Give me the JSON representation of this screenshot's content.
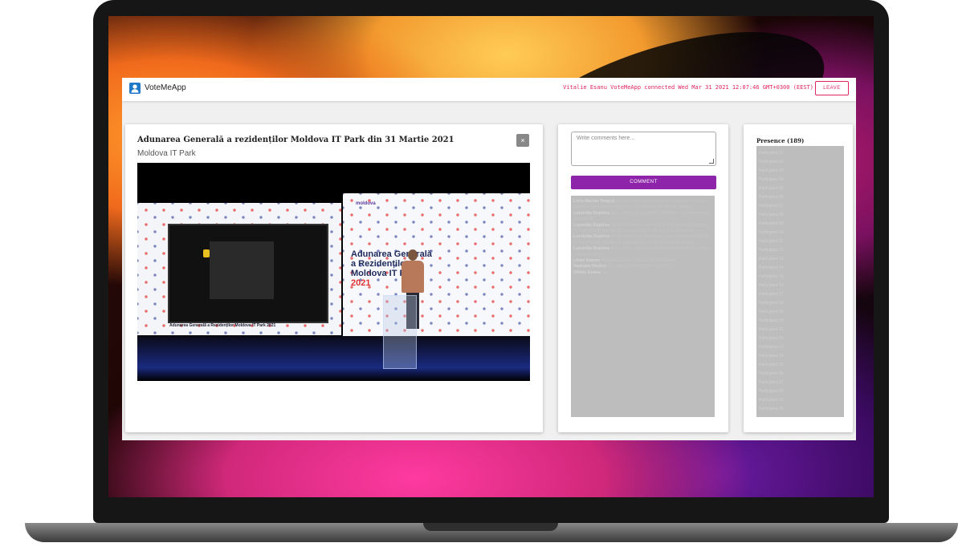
{
  "header": {
    "app_title": "VoteMeApp",
    "status": "Vitalie Esanu VoteMeApp connected Wed Mar 31 2021 12:07:46 GMT+0300 (EEST)",
    "leave_label": "LEAVE"
  },
  "meeting": {
    "title": "Adunarea Generală a rezidenților Moldova IT Park din 31 Martie 2021",
    "organization": "Moldova IT Park",
    "close_label": "×",
    "video": {
      "left_caption": "Adunarea Generală a Rezidenților Moldova IT Park 2021",
      "right_logo": "moldova",
      "right_heading_1": "Adunarea Generală",
      "right_heading_2": "a Rezidenților",
      "right_heading_3": "Moldova IT Park",
      "right_year": "2021"
    }
  },
  "comments": {
    "placeholder": "Write comments here...",
    "button_label": "COMMENT",
    "items": [
      {
        "author": "Liviu Marian Negruț",
        "text": "Permis slide-ul prezentat mai departe a ca sa raportul rezultatele in engleza sau romana pe adunari anuala"
      },
      {
        "author": "Luminița Dupîrea",
        "text": "Elise afisează de grande a trimitere la prezentarea uploadată"
      },
      {
        "author": "Luminița Dupîrea",
        "text": "Tema: Adunarea Generală a Rezidenților Moldova IT Park (Q&A) Atenție 31 martie 2021 11:00 AM Ora Moldovei"
      },
      {
        "author": "Luminița Dupîrea",
        "text": "Tema: Adunarea Generală a Rezidenților Moldova IT Park (Q&A) Atenție 31 martie 2021 11:00 AM Ora Moldovei"
      },
      {
        "author": "Luminița Dupîrea",
        "text": "Bună ziua, vă rugăm să lăsați întrebările aici pentru sesiunea Q&A"
      },
      {
        "author": "Lilian Ivanov",
        "text": "Întrebare pentru Q&A după prezentare"
      },
      {
        "author": "Nadejda Hodiuc",
        "text": "Da, aștept răspunsurile voastre"
      },
      {
        "author": "Vitalie Esanu",
        "text": "Da"
      }
    ]
  },
  "presence": {
    "title": "Presence (189)",
    "members": [
      "Participant 01",
      "Participant 02",
      "Participant 03",
      "Participant 04",
      "Participant 05",
      "Participant 06",
      "Participant 07",
      "Participant 08",
      "Participant 09",
      "Participant 10",
      "Participant 11",
      "Participant 12",
      "Participant 13",
      "Participant 14",
      "Participant 15",
      "Participant 16",
      "Participant 17",
      "Participant 18",
      "Participant 19",
      "Participant 20",
      "Participant 21",
      "Participant 22",
      "Participant 23",
      "Participant 24",
      "Participant 25",
      "Participant 26",
      "Participant 27",
      "Participant 28",
      "Participant 29",
      "Participant 30"
    ]
  }
}
